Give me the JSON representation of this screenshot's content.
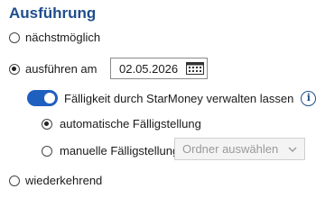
{
  "section_title": "Ausführung",
  "options": {
    "next_possible": {
      "label": "nächstmöglich",
      "selected": false
    },
    "execute_on": {
      "label": "ausführen am",
      "selected": true,
      "date": "02.05.2026"
    },
    "recurring": {
      "label": "wiederkehrend",
      "selected": false
    }
  },
  "due_management": {
    "toggle_label": "Fälligkeit durch StarMoney verwalten lassen",
    "enabled": true,
    "auto_label": "automatische Fälligstellung",
    "auto_selected": true,
    "manual_label": "manuelle Fälligstellung",
    "manual_selected": false,
    "folder_select_placeholder": "Ordner auswählen"
  },
  "icons": {
    "calendar": "calendar-icon",
    "info": "info-icon",
    "chevron": "chevron-down-icon"
  },
  "colors": {
    "title": "#1f4e8c",
    "toggle_on": "#1f5fbf",
    "disabled_text": "#9a9a9a"
  }
}
